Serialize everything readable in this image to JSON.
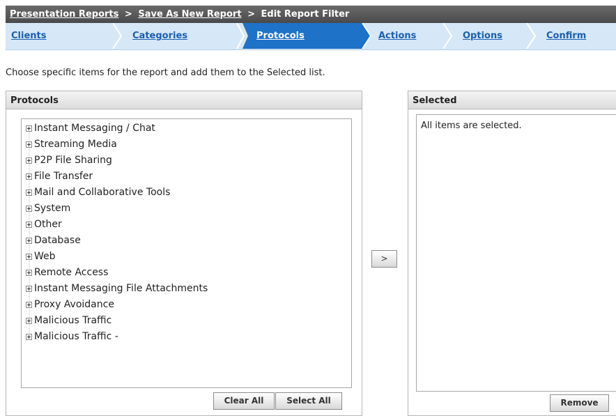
{
  "breadcrumb": {
    "link1": "Presentation Reports",
    "sep1": ">",
    "link2": "Save As New Report",
    "sep2": ">",
    "current": "Edit Report Filter"
  },
  "steps": [
    {
      "label": "Clients",
      "active": false
    },
    {
      "label": "Categories",
      "active": false
    },
    {
      "label": "Protocols",
      "active": true
    },
    {
      "label": "Actions",
      "active": false
    },
    {
      "label": "Options",
      "active": false
    },
    {
      "label": "Confirm",
      "active": false
    }
  ],
  "instruction": "Choose specific items for the report and add them to the Selected list.",
  "protocols_panel": {
    "title": "Protocols",
    "items": [
      "Instant Messaging / Chat",
      "Streaming Media",
      "P2P File Sharing",
      "File Transfer",
      "Mail and Collaborative Tools",
      "System",
      "Other",
      "Database",
      "Web",
      "Remote Access",
      "Instant Messaging File Attachments",
      "Proxy Avoidance",
      "Malicious Traffic",
      "Malicious Traffic -"
    ],
    "clear_all_label": "Clear All",
    "select_all_label": "Select All"
  },
  "add_button_label": ">",
  "selected_panel": {
    "title": "Selected",
    "message": "All items are selected.",
    "remove_label": "Remove"
  },
  "colors": {
    "breadcrumb_bg": "#555555",
    "steps_bg": "#d6e7f7",
    "active_step_bg": "#1e72c8",
    "link": "#1a5fb0"
  }
}
